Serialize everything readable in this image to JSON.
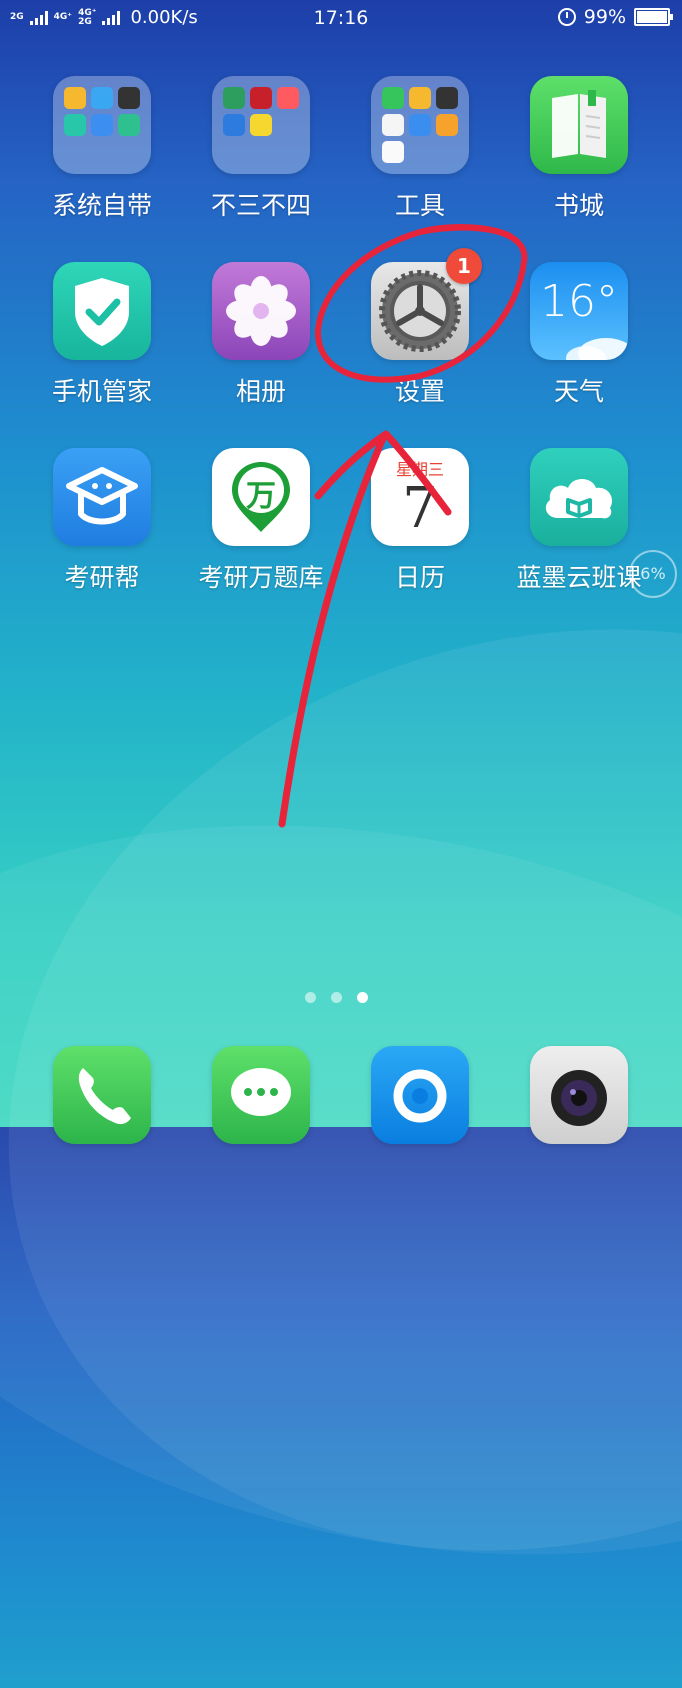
{
  "status_bar": {
    "network_top": "2G",
    "network_4g_1": "4G⁺",
    "network_4g_2": "4G⁺",
    "network_2g": "2G",
    "speed": "0.00K/s",
    "time": "17:16",
    "battery": "99%"
  },
  "apps": [
    {
      "label": "系统自带"
    },
    {
      "label": "不三不四"
    },
    {
      "label": "工具"
    },
    {
      "label": "书城"
    },
    {
      "label": "手机管家"
    },
    {
      "label": "相册"
    },
    {
      "label": "设置",
      "badge": "1"
    },
    {
      "label": "天气",
      "temp": "16°"
    },
    {
      "label": "考研帮"
    },
    {
      "label": "考研万题库",
      "logo_text": "万"
    },
    {
      "label": "日历",
      "weekday": "星期三",
      "day": "7"
    },
    {
      "label": "蓝墨云班课"
    }
  ],
  "dock": [
    {
      "icon": "phone-icon"
    },
    {
      "icon": "messages-icon"
    },
    {
      "icon": "browser-icon"
    },
    {
      "icon": "camera-icon"
    }
  ],
  "floating_widget": "6%",
  "page_indicator": {
    "count": 3,
    "active": 3
  },
  "colors": {
    "badge": "#f04a3a",
    "annotation": "#e8243a"
  }
}
